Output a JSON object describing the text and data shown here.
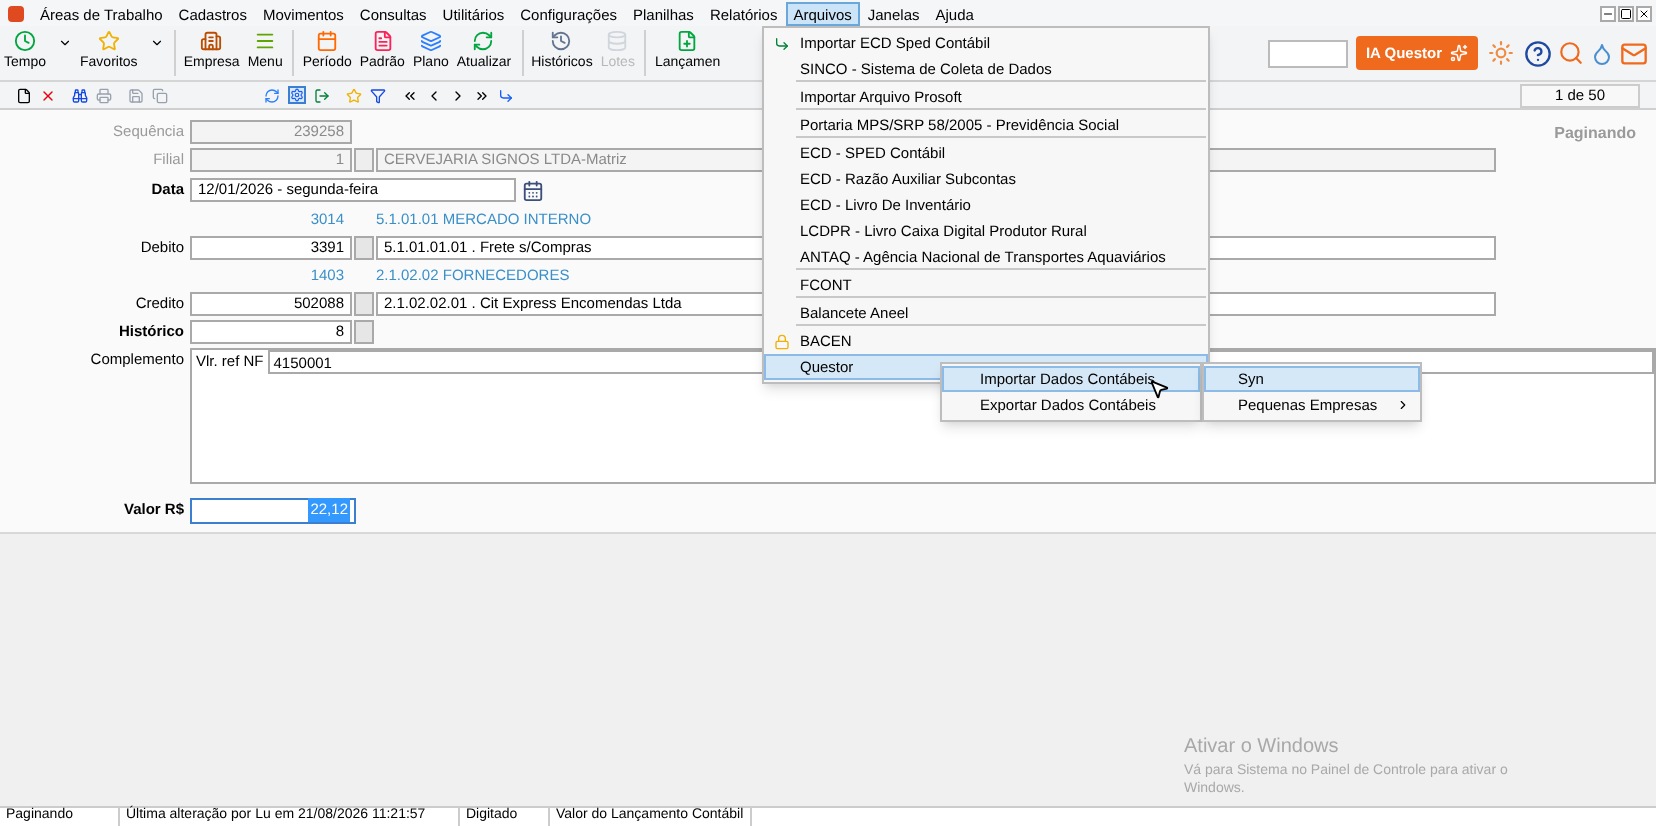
{
  "menu_bar": [
    {
      "label": "Áreas de Trabalho",
      "selected": false
    },
    {
      "label": "Cadastros",
      "selected": false
    },
    {
      "label": "Movimentos",
      "selected": false
    },
    {
      "label": "Consultas",
      "selected": false
    },
    {
      "label": "Utilitários",
      "selected": false
    },
    {
      "label": "Configurações",
      "selected": false
    },
    {
      "label": "Planilhas",
      "selected": false
    },
    {
      "label": "Relatórios",
      "selected": false
    },
    {
      "label": "Arquivos",
      "selected": true
    },
    {
      "label": "Janelas",
      "selected": false
    },
    {
      "label": "Ajuda",
      "selected": false
    }
  ],
  "toolbar": [
    {
      "label": "Tempo",
      "dropdown": true,
      "disabled": false
    },
    {
      "label": "Favoritos",
      "dropdown": true,
      "disabled": false
    },
    {
      "label": "Empresa",
      "dropdown": false,
      "disabled": false
    },
    {
      "label": "Menu",
      "dropdown": false,
      "disabled": false
    },
    {
      "label": "Período",
      "dropdown": false,
      "disabled": false
    },
    {
      "label": "Padrão",
      "dropdown": false,
      "disabled": false
    },
    {
      "label": "Plano",
      "dropdown": false,
      "disabled": false
    },
    {
      "label": "Atualizar",
      "dropdown": false,
      "disabled": false
    },
    {
      "label": "Históricos",
      "dropdown": false,
      "disabled": false
    },
    {
      "label": "Lotes",
      "dropdown": false,
      "disabled": true
    },
    {
      "label": "Lançamen",
      "dropdown": false,
      "disabled": false
    }
  ],
  "ia_button": {
    "label": "IA Questor"
  },
  "pager": {
    "label": "1 de 50"
  },
  "mode_label": "Paginando",
  "form": [
    {
      "kind": "code",
      "label": "Sequência",
      "disabled": true,
      "bold": false,
      "value": "239258"
    },
    {
      "kind": "lookup",
      "label": "Filial",
      "disabled": true,
      "bold": false,
      "value": "1",
      "description": "CERVEJARIA SIGNOS LTDA-Matriz"
    },
    {
      "kind": "date",
      "label": "Data",
      "disabled": false,
      "bold": true,
      "value": "12/01/2026 - segunda-feira"
    },
    {
      "kind": "info",
      "code": "3014",
      "account": "5.1.01.01  MERCADO INTERNO"
    },
    {
      "kind": "lookup",
      "label": "Debito",
      "disabled": false,
      "bold": false,
      "value": "3391",
      "description": "5.1.01.01.01 .  Frete s/Compras"
    },
    {
      "kind": "info",
      "code": "1403",
      "account": "2.1.02.02  FORNECEDORES"
    },
    {
      "kind": "lookup",
      "label": "Credito",
      "disabled": false,
      "bold": false,
      "value": "502088",
      "description": "2.1.02.02.01 .  Cit Express Encomendas Ltda"
    },
    {
      "kind": "lookup",
      "label": "Histórico",
      "disabled": false,
      "bold": true,
      "value": "8"
    },
    {
      "kind": "memo",
      "label": "Complemento",
      "disabled": false,
      "bold": false,
      "prefix": "Vlr. ref  NF",
      "value": "4150001"
    },
    {
      "kind": "amount",
      "label": "Valor R$",
      "disabled": false,
      "bold": true,
      "value": "22,12"
    }
  ],
  "arquivos_menu": [
    {
      "label": "Importar ECD Sped Contábil",
      "kind": "import",
      "separator_after": false,
      "selected": false
    },
    {
      "label": "SINCO - Sistema de Coleta de Dados",
      "kind": "plain",
      "separator_after": true,
      "selected": false
    },
    {
      "label": "Importar Arquivo Prosoft",
      "kind": "plain",
      "separator_after": true,
      "selected": false
    },
    {
      "label": "Portaria MPS/SRP 58/2005 - Previdência Social",
      "kind": "plain",
      "separator_after": true,
      "selected": false
    },
    {
      "label": "ECD - SPED Contábil",
      "kind": "plain",
      "separator_after": false,
      "selected": false
    },
    {
      "label": "ECD - Razão Auxiliar Subcontas",
      "kind": "plain",
      "separator_after": false,
      "selected": false
    },
    {
      "label": "ECD - Livro De Inventário",
      "kind": "plain",
      "separator_after": false,
      "selected": false
    },
    {
      "label": "LCDPR - Livro Caixa Digital Produtor Rural",
      "kind": "plain",
      "separator_after": false,
      "selected": false
    },
    {
      "label": "ANTAQ - Agência Nacional de Transportes Aquaviários",
      "kind": "plain",
      "separator_after": true,
      "selected": false
    },
    {
      "label": "FCONT",
      "kind": "plain",
      "separator_after": true,
      "selected": false
    },
    {
      "label": "Balancete Aneel",
      "kind": "plain",
      "separator_after": true,
      "selected": false
    },
    {
      "label": "BACEN",
      "kind": "locked",
      "separator_after": false,
      "selected": false
    },
    {
      "label": "Questor",
      "kind": "plain",
      "separator_after": false,
      "selected": true
    }
  ],
  "questor_submenu": [
    {
      "label": "Importar Dados Contábeis",
      "selected": true,
      "submenu": false
    },
    {
      "label": "Exportar Dados Contábeis",
      "selected": false,
      "submenu": false
    }
  ],
  "import_submenu": [
    {
      "label": "Syn",
      "selected": true,
      "submenu": false
    },
    {
      "label": "Pequenas Empresas",
      "selected": false,
      "submenu": true
    }
  ],
  "activation_notice": {
    "title": "Ativar o Windows",
    "message": "Vá para Sistema no Painel de Controle para ativar o Windows."
  },
  "status_bar": [
    "Paginando",
    "Última alteração por Lu em 21/08/2026 11:21:57",
    "Digitado",
    "Valor do Lançamento Contábil"
  ]
}
